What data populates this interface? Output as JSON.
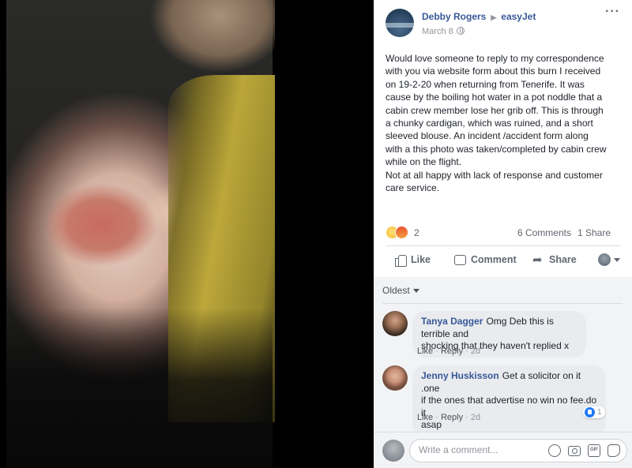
{
  "post": {
    "author": "Debby Rogers",
    "target": "easyJet",
    "date": "March 8",
    "body_lines": [
      "Would love someone to reply to my correspondence",
      "with you via website form about this burn I received",
      "on 19-2-20 when returning from Tenerife. It was",
      "cause by the boiling hot water in a pot noddle that a",
      "cabin crew member lose her grib off. This is through",
      "a chunky cardigan, which was ruined, and a short",
      "sleeved blouse. An incident /accident form along",
      "with a this photo was taken/completed by cabin crew",
      "while on the flight.",
      "Not at all happy with lack of response and customer",
      "care service."
    ],
    "reaction_count": "2",
    "comments_count": "6 Comments",
    "shares_count": "1 Share",
    "reaction_icons": [
      "sad-reaction",
      "angry-reaction"
    ]
  },
  "actions": {
    "like": "Like",
    "comment": "Comment",
    "share": "Share"
  },
  "comments": {
    "sort_label": "Oldest",
    "items": [
      {
        "author": "Tanya Dagger",
        "text_lines": [
          "Omg Deb this is terrible and",
          "shocking that they haven't replied x"
        ],
        "like_label": "Like",
        "reply_label": "Reply",
        "age": "2d"
      },
      {
        "author": "Jenny Huskisson",
        "text_lines": [
          "Get a solicitor on it .one",
          "if the ones that advertise no win no fee.do it",
          "asap"
        ],
        "like_label": "Like",
        "reply_label": "Reply",
        "age": "2d",
        "likes": "1"
      }
    ]
  },
  "composer": {
    "placeholder": "Write a comment..."
  },
  "colors": {
    "link_blue": "#385898",
    "meta_gray": "#90949c",
    "like_blue": "#2078f4",
    "photo_sweater": "#c2ad3a"
  }
}
